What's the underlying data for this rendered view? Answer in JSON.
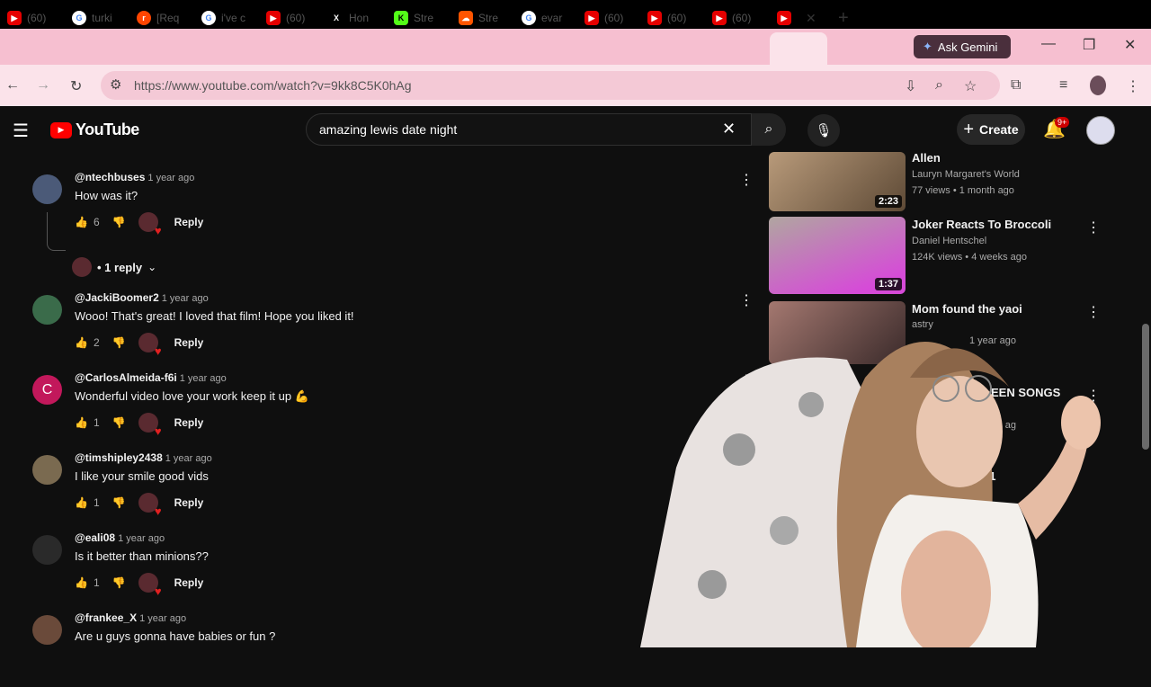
{
  "browser": {
    "tabs": [
      {
        "label": "(60)",
        "icon": "youtube-icon"
      },
      {
        "label": "turki",
        "icon": "google-icon"
      },
      {
        "label": "[Req",
        "icon": "reddit-icon"
      },
      {
        "label": "i've c",
        "icon": "google-icon"
      },
      {
        "label": "(60)",
        "icon": "youtube-icon"
      },
      {
        "label": "Hon",
        "icon": "x-icon"
      },
      {
        "label": "Stre",
        "icon": "kick-icon"
      },
      {
        "label": "Stre",
        "icon": "soundcloud-icon"
      },
      {
        "label": "evar",
        "icon": "google-icon"
      },
      {
        "label": "(60)",
        "icon": "youtube-icon"
      },
      {
        "label": "(60)",
        "icon": "youtube-icon"
      },
      {
        "label": "(60)",
        "icon": "youtube-icon"
      }
    ],
    "ask_gemini": "Ask Gemini",
    "url": "https://www.youtube.com/watch?v=9kk8C5K0hAg"
  },
  "youtube": {
    "logo": "YouTube",
    "search_value": "amazing lewis date night",
    "create_label": "Create",
    "notif_count": "9+"
  },
  "comments": {
    "first": {
      "user": "@ntechbuses",
      "time": "1 year ago",
      "text": "How was it?",
      "likes": "6",
      "reply": "Reply",
      "replies_toggle": "• 1 reply"
    },
    "list": [
      {
        "user": "@JackiBoomer2",
        "time": "1 year ago",
        "text": "Wooo! That's great! I loved that film! Hope you liked it!",
        "likes": "2",
        "reply": "Reply"
      },
      {
        "user": "@CarlosAlmeida-f6i",
        "time": "1 year ago",
        "text": "Wonderful video love your work keep it up 💪",
        "likes": "1",
        "reply": "Reply",
        "avatar_letter": "C"
      },
      {
        "user": "@timshipley2438",
        "time": "1 year ago",
        "text": "I like your smile good vids",
        "likes": "1",
        "reply": "Reply"
      },
      {
        "user": "@eali08",
        "time": "1 year ago",
        "text": "Is it better than minions??",
        "likes": "1",
        "reply": "Reply"
      },
      {
        "user": "@frankee_X",
        "time": "1 year ago",
        "text": "Are u guys gonna have babies or fun ?"
      }
    ]
  },
  "sidebar": {
    "videos": [
      {
        "title": "Allen",
        "channel": "Lauryn Margaret's World",
        "meta": "77 views • 1 month ago",
        "duration": "2:23"
      },
      {
        "title": "Joker Reacts To Broccoli",
        "channel": "Daniel Hentschel",
        "meta": "124K views • 4 weeks ago",
        "duration": "1:37"
      },
      {
        "title": "Mom found the yaoi",
        "channel": "astry",
        "meta": "1 year ago"
      },
      {
        "title": "EEN SONGS",
        "meta": "ths ag"
      },
      {
        "title": "art 1"
      }
    ]
  }
}
